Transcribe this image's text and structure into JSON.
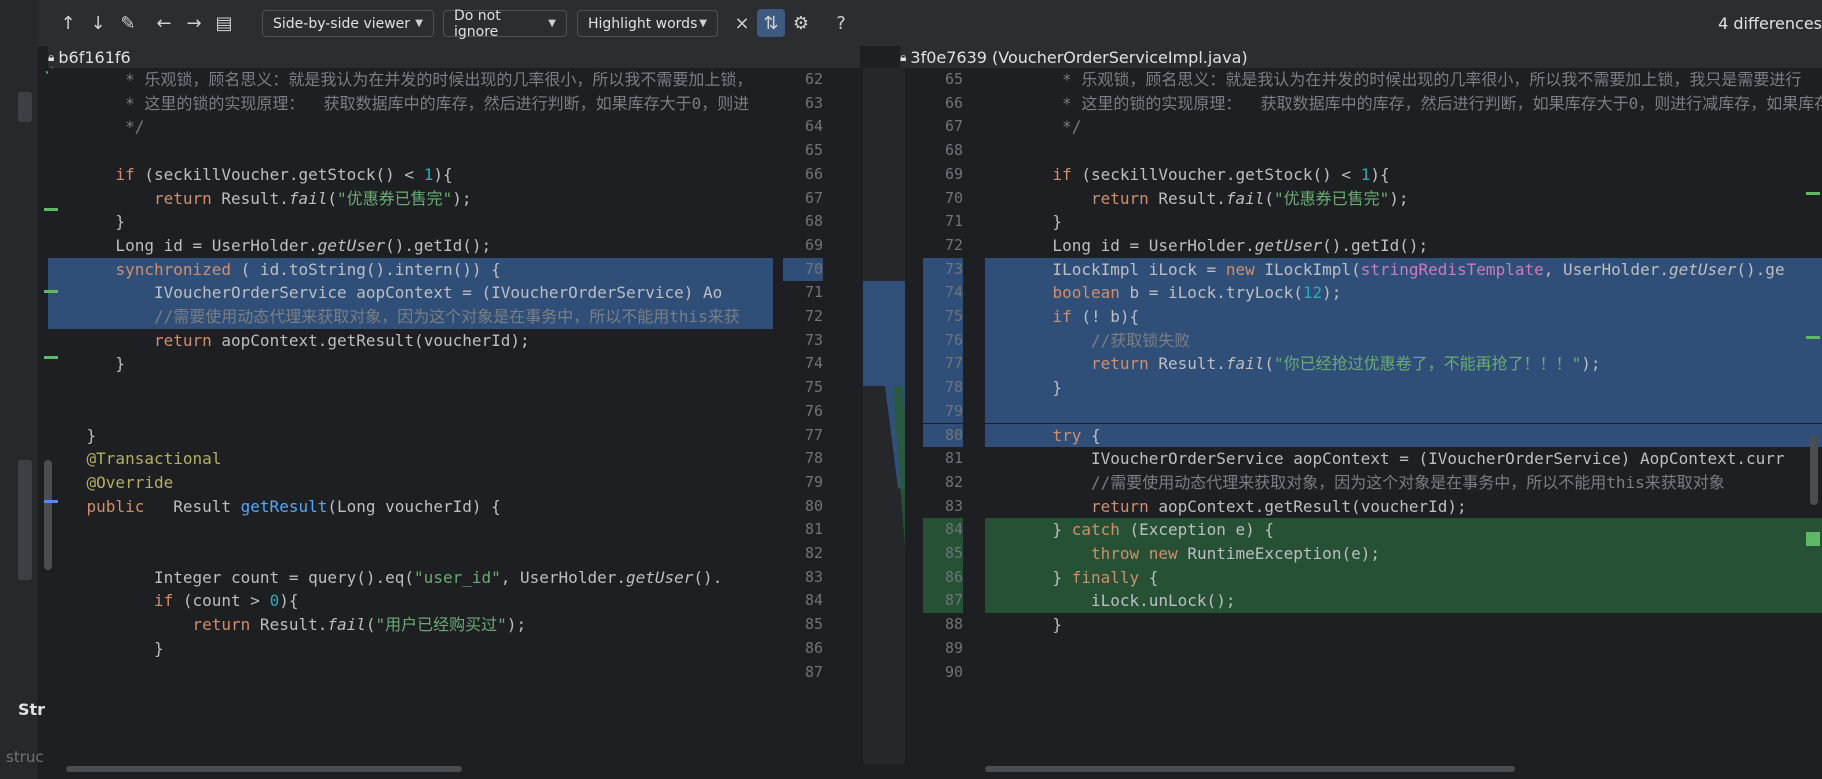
{
  "toolbar": {
    "viewer_label": "Side-by-side viewer",
    "ignore_label": "Do not ignore",
    "highlight_label": "Highlight words",
    "help_label": "?",
    "diff_count": "4 differences"
  },
  "left_header": "b6f161f6",
  "right_header": "3f0e7639 (VoucherOrderServiceImpl.java)",
  "sidebar": {
    "structure_label": "Str",
    "structure_small": "struc"
  },
  "left_numbers": [
    "62",
    "63",
    "64",
    "65",
    "66",
    "67",
    "68",
    "69",
    "70",
    "71",
    "72",
    "73",
    "74",
    "75",
    "76",
    "77",
    "78",
    "79",
    "80",
    "81",
    "82",
    "83",
    "84",
    "85",
    "86",
    "87"
  ],
  "right_numbers": [
    "65",
    "66",
    "67",
    "68",
    "69",
    "70",
    "71",
    "72",
    "73",
    "74",
    "75",
    "76",
    "77",
    "78",
    "79",
    "80",
    "81",
    "82",
    "83",
    "84",
    "85",
    "86",
    "87",
    "88",
    "89",
    "90"
  ],
  "left_code": [
    "        * 乐观锁，顾名思义：就是我认为在并发的时候出现的几率很小，所以我不需要加上锁，",
    "        * 这里的锁的实现原理：  获取数据库中的库存，然后进行判断，如果库存大于0，则进",
    "        */",
    "",
    "       if (seckillVoucher.getStock() < 1){",
    "           return Result.fail(\"优惠券已售完\");",
    "       }",
    "       Long id = UserHolder.getUser().getId();",
    "       synchronized ( id.toString().intern()) {",
    "           IVoucherOrderService aopContext = (IVoucherOrderService) Ao",
    "           //需要使用动态代理来获取对象，因为这个对象是在事务中，所以不能用this来获",
    "           return aopContext.getResult(voucherId);",
    "       }",
    "",
    "",
    "    }",
    "    @Transactional",
    "    @Override",
    "    public   Result getResult(Long voucherId) {",
    "",
    "",
    "           Integer count = query().eq(\"user_id\", UserHolder.getUser().",
    "           if (count > 0){",
    "               return Result.fail(\"用户已经购买过\");",
    "           }",
    ""
  ],
  "right_code": [
    "        * 乐观锁，顾名思义：就是我认为在并发的时候出现的几率很小，所以我不需要加上锁，我只是需要进行",
    "        * 这里的锁的实现原理：  获取数据库中的库存，然后进行判断，如果库存大于0，则进行减库存，如果库存",
    "        */",
    "",
    "       if (seckillVoucher.getStock() < 1){",
    "           return Result.fail(\"优惠券已售完\");",
    "       }",
    "       Long id = UserHolder.getUser().getId();",
    "       ILockImpl iLock = new ILockImpl(stringRedisTemplate, UserHolder.getUser().ge",
    "       boolean b = iLock.tryLock(12);",
    "       if (! b){",
    "           //获取锁失败",
    "           return Result.fail(\"你已经抢过优惠卷了，不能再抢了！！！\");",
    "       }",
    "",
    "       try {",
    "           IVoucherOrderService aopContext = (IVoucherOrderService) AopContext.curr",
    "           //需要使用动态代理来获取对象，因为这个对象是在事务中，所以不能用this来获取对象",
    "           return aopContext.getResult(voucherId);",
    "       } catch (Exception e) {",
    "           throw new RuntimeException(e);",
    "       } finally {",
    "           iLock.unLock();",
    "       }",
    "",
    ""
  ],
  "colors": {
    "modified": "#345887",
    "added": "#285a37",
    "background": "#1e1f22"
  }
}
